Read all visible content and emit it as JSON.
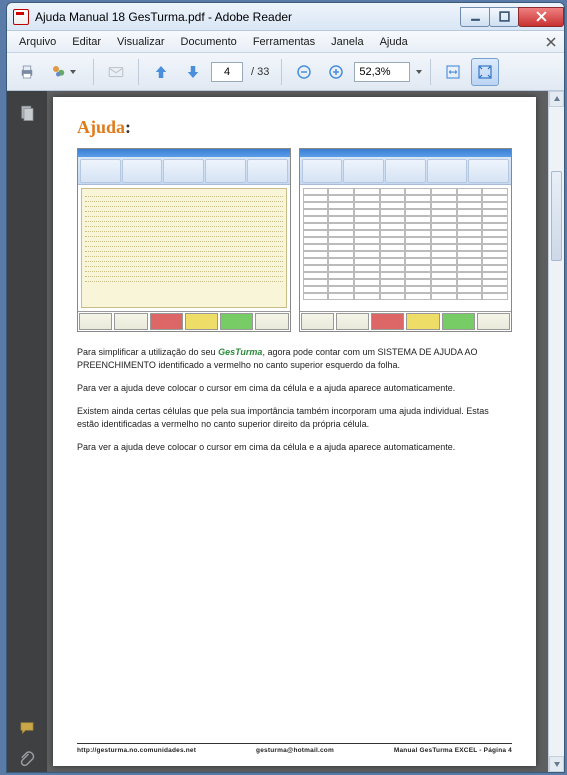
{
  "window": {
    "title": "Ajuda Manual 18 GesTurma.pdf - Adobe Reader"
  },
  "menu": {
    "items": [
      "Arquivo",
      "Editar",
      "Visualizar",
      "Documento",
      "Ferramentas",
      "Janela",
      "Ajuda"
    ]
  },
  "toolbar": {
    "page_current": "4",
    "page_total": "/ 33",
    "zoom": "52,3%"
  },
  "document": {
    "heading": "Ajuda",
    "heading_colon": ":",
    "p1_a": "Para simplificar a utilização do seu ",
    "p1_gt": "GesTurma",
    "p1_b": ", agora pode contar com um SISTEMA DE AJUDA AO PREENCHIMENTO identificado a vermelho no canto superior esquerdo da folha.",
    "p2": "Para ver a ajuda deve colocar o cursor em cima da célula e a ajuda aparece automaticamente.",
    "p3": "Existem ainda certas células que pela sua importância também incorporam uma ajuda individual. Estas estão identificadas a vermelho no canto superior direito da própria célula.",
    "p4": "Para ver a ajuda deve colocar o cursor em cima da célula e a ajuda aparece automaticamente."
  },
  "footer": {
    "left": "http://gesturma.no.comunidades.net",
    "center": "gesturma@hotmail.com",
    "right": "Manual GesTurma EXCEL - Página 4"
  }
}
